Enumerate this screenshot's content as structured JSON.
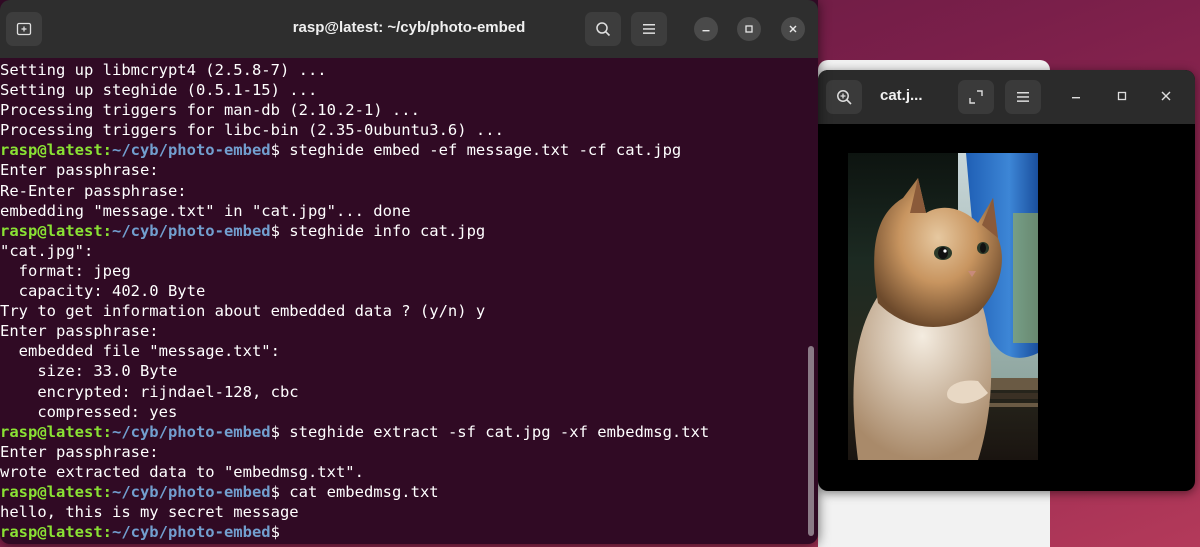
{
  "terminal": {
    "title": "rasp@latest: ~/cyb/photo-embed",
    "prompt_user": "rasp@latest:",
    "prompt_path": "~/cyb/photo-embed",
    "prompt_symbol": "$",
    "lines": [
      {
        "type": "out",
        "text": "Setting up libmcrypt4 (2.5.8-7) ..."
      },
      {
        "type": "out",
        "text": "Setting up steghide (0.5.1-15) ..."
      },
      {
        "type": "out",
        "text": "Processing triggers for man-db (2.10.2-1) ..."
      },
      {
        "type": "out",
        "text": "Processing triggers for libc-bin (2.35-0ubuntu3.6) ..."
      },
      {
        "type": "cmd",
        "text": " steghide embed -ef message.txt -cf cat.jpg"
      },
      {
        "type": "out",
        "text": "Enter passphrase:"
      },
      {
        "type": "out",
        "text": "Re-Enter passphrase:"
      },
      {
        "type": "out",
        "text": "embedding \"message.txt\" in \"cat.jpg\"... done"
      },
      {
        "type": "cmd",
        "text": " steghide info cat.jpg"
      },
      {
        "type": "out",
        "text": "\"cat.jpg\":"
      },
      {
        "type": "out",
        "text": "  format: jpeg"
      },
      {
        "type": "out",
        "text": "  capacity: 402.0 Byte"
      },
      {
        "type": "out",
        "text": "Try to get information about embedded data ? (y/n) y"
      },
      {
        "type": "out",
        "text": "Enter passphrase:"
      },
      {
        "type": "out",
        "text": "  embedded file \"message.txt\":"
      },
      {
        "type": "out",
        "text": "    size: 33.0 Byte"
      },
      {
        "type": "out",
        "text": "    encrypted: rijndael-128, cbc"
      },
      {
        "type": "out",
        "text": "    compressed: yes"
      },
      {
        "type": "cmd",
        "text": " steghide extract -sf cat.jpg -xf embedmsg.txt"
      },
      {
        "type": "out",
        "text": "Enter passphrase:"
      },
      {
        "type": "out",
        "text": "wrote extracted data to \"embedmsg.txt\"."
      },
      {
        "type": "cmd",
        "text": " cat embedmsg.txt"
      },
      {
        "type": "out",
        "text": "hello, this is my secret message"
      },
      {
        "type": "cmd",
        "text": ""
      }
    ],
    "icons": {
      "new_tab": "new-tab-icon",
      "search": "search-icon",
      "menu": "hamburger-menu-icon",
      "minimize": "minimize-icon",
      "maximize": "maximize-icon",
      "close": "close-icon"
    },
    "colors": {
      "background": "#300a24",
      "prompt_user": "#8ae234",
      "prompt_path": "#729fcf"
    }
  },
  "viewer": {
    "title": "cat.j...",
    "icons": {
      "zoom": "zoom-in-icon",
      "fullscreen": "fullscreen-icon",
      "menu": "hamburger-menu-icon",
      "minimize": "minimize-icon",
      "maximize": "maximize-icon",
      "close": "close-icon"
    }
  }
}
